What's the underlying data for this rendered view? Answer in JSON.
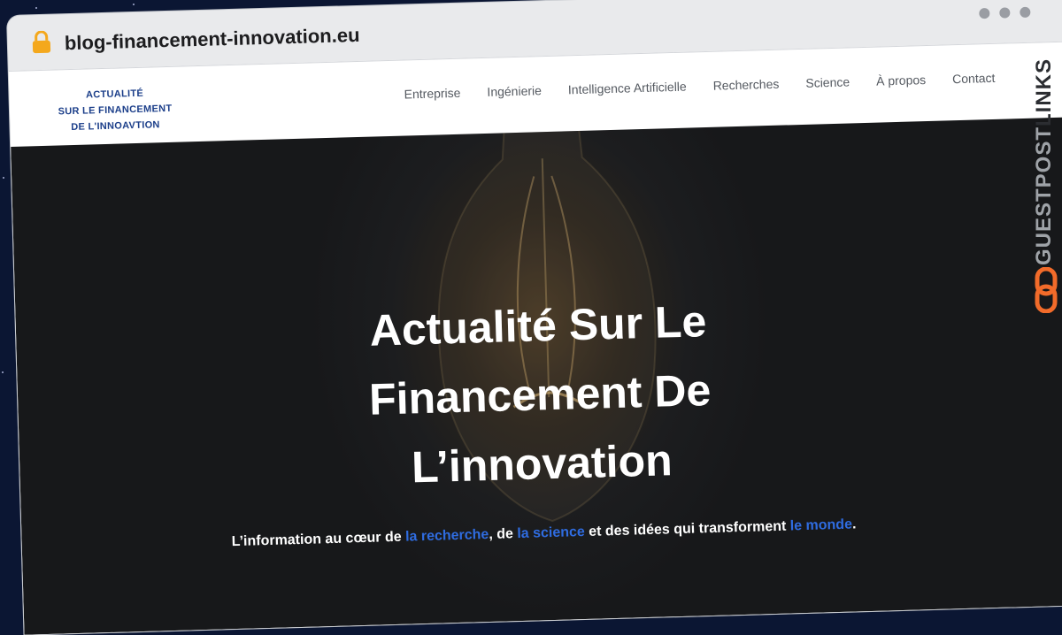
{
  "browser": {
    "url": "blog-financement-innovation.eu",
    "lock_icon": "lock-icon",
    "window_dots": [
      "dot",
      "dot",
      "dot"
    ]
  },
  "site": {
    "logo": {
      "line1": "ACTUALITÉ",
      "line2": "SUR LE FINANCEMENT",
      "line3": "DE L'INNOAVTION"
    },
    "nav": [
      {
        "label": "Entreprise"
      },
      {
        "label": "Ingénierie"
      },
      {
        "label": "Intelligence Artificielle"
      },
      {
        "label": "Recherches"
      },
      {
        "label": "Science"
      },
      {
        "label": "À propos"
      },
      {
        "label": "Contact"
      }
    ],
    "hero": {
      "title_line1": "Actualité Sur Le",
      "title_line2": "Financement De",
      "title_line3": "L’innovation",
      "sub_prefix": "L’information au cœur de ",
      "sub_link1": "la recherche",
      "sub_mid1": ", de ",
      "sub_link2": "la science",
      "sub_mid2": " et des idées qui transforment ",
      "sub_link3": "le monde",
      "sub_suffix": "."
    }
  },
  "badge": {
    "guestpost": "GUESTPOST",
    "links": "LINKS",
    "icon": "link-chain-icon"
  },
  "colors": {
    "accent_link": "#2f6ce0",
    "logo_blue": "#1c3f8a",
    "badge_orange": "#f26b2a"
  }
}
